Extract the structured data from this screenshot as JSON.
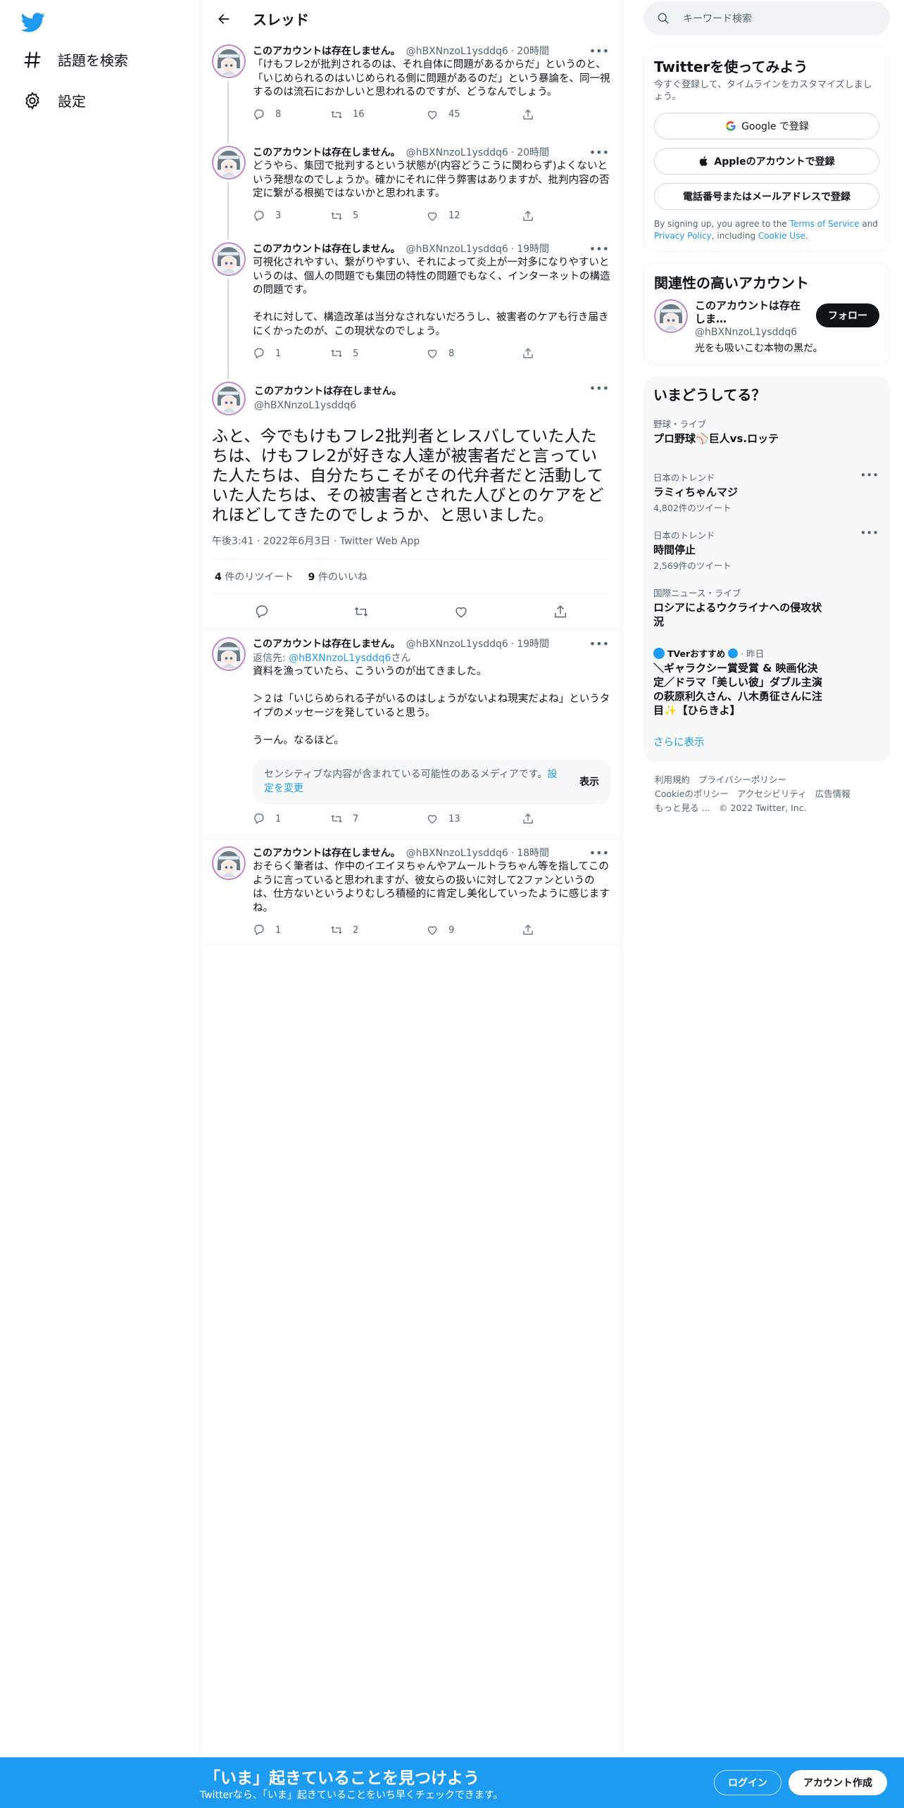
{
  "colors": {
    "accent": "#1d9bf0",
    "text": "#0f1419",
    "muted": "#536471"
  },
  "nav": {
    "explore": "話題を検索",
    "settings": "設定"
  },
  "header": {
    "title": "スレッド"
  },
  "tweets": [
    {
      "name": "このアカウントは存在しません。",
      "handle": "@hBXNnzoL1ysddq6",
      "time": "20時間",
      "text": "「けもフレ2が批判されるのは、それ自体に問題があるからだ」というのと、「いじめられるのはいじめられる側に問題があるのだ」という暴論を、同一視するのは流石におかしいと思われるのですが、どうなんでしょう。",
      "replies": "8",
      "retweets": "16",
      "likes": "45"
    },
    {
      "name": "このアカウントは存在しません。",
      "handle": "@hBXNnzoL1ysddq6",
      "time": "20時間",
      "text": "どうやら、集団で批判するという状態が(内容どうこうに関わらず)よくないという発想なのでしょうか。確かにそれに伴う弊害はありますが、批判内容の否定に繋がる根拠ではないかと思われます。",
      "replies": "3",
      "retweets": "5",
      "likes": "12"
    },
    {
      "name": "このアカウントは存在しません。",
      "handle": "@hBXNnzoL1ysddq6",
      "time": "19時間",
      "text": "可視化されやすい、繋がりやすい、それによって炎上が一対多になりやすいというのは、個人の問題でも集団の特性の問題でもなく、インターネットの構造の問題です。\n\nそれに対して、構造改革は当分なされないだろうし、被害者のケアも行き届きにくかったのが、この現状なのでしょう。",
      "replies": "1",
      "retweets": "5",
      "likes": "8"
    }
  ],
  "focal": {
    "name": "このアカウントは存在しません。",
    "handle": "@hBXNnzoL1ysddq6",
    "text": "ふと、今でもけもフレ2批判者とレスバしていた人たちは、けもフレ2が好きな人達が被害者だと言っていた人たちは、自分たちこそがその代弁者だと活動していた人たちは、その被害者とされた人びとのケアをどれほどしてきたのでしょうか、と思いました。",
    "meta": "午後3:41 · 2022年6月3日 · Twitter Web App",
    "retweet_count": "4",
    "retweet_label": "件のリツイート",
    "like_count": "9",
    "like_label": "件のいいね"
  },
  "replies": [
    {
      "name": "このアカウントは存在しません。",
      "handle": "@hBXNnzoL1ysddq6",
      "time": "19時間",
      "reply_prefix": "返信先: ",
      "reply_handle": "@hBXNnzoL1ysddq6",
      "reply_suffix": "さん",
      "text": "資料を漁っていたら、こういうのが出てきました。\n\n＞２は「いじらめられる子がいるのはしょうがないよね現実だよね」というタイプのメッセージを発していると思う。\n\nうーん。なるほど。",
      "sensitive_msg": "センシティブな内容が含まれている可能性のあるメディアです。",
      "sensitive_link": "設定を変更",
      "sensitive_show": "表示",
      "replies": "1",
      "retweets": "7",
      "likes": "13"
    },
    {
      "name": "このアカウントは存在しません。",
      "handle": "@hBXNnzoL1ysddq6",
      "time": "18時間",
      "text": "おそらく筆者は、作中のイエイヌちゃんやアムールトラちゃん等を指してこのように言っていると思われますが、彼女らの扱いに対して2ファンというのは、仕方ないというよりむしろ積極的に肯定し美化していったように感じますね。",
      "replies": "1",
      "retweets": "2",
      "likes": "9"
    }
  ],
  "search": {
    "placeholder": "キーワード検索"
  },
  "signup_card": {
    "title": "Twitterを使ってみよう",
    "sub": "今すぐ登録して、タイムラインをカスタマイズしましょう。",
    "google": "Google で登録",
    "apple": "Appleのアカウントで登録",
    "phone": "電話番号またはメールアドレスで登録",
    "legal_1": "By signing up, you agree to the ",
    "tos": "Terms of Service",
    "legal_2": " and ",
    "privacy": "Privacy Policy",
    "legal_3": ", including ",
    "cookie": "Cookie Use",
    "legal_4": "."
  },
  "related": {
    "title": "関連性の高いアカウント",
    "name": "このアカウントは存在しま…",
    "handle": "@hBXNnzoL1ysddq6",
    "bio": "光をも吸いこむ本物の黒だ。",
    "follow": "フォロー"
  },
  "trends": {
    "title": "いまどうしてる？",
    "items": [
      {
        "cat": "野球・ライブ",
        "title": "プロ野球⚾巨人vs.ロッテ",
        "count": ""
      },
      {
        "cat": "日本のトレンド",
        "title": "ラミィちゃんマジ",
        "count": "4,802件のツイート"
      },
      {
        "cat": "日本のトレンド",
        "title": "時間停止",
        "count": "2,569件のツイート"
      },
      {
        "cat": "国際ニュース・ライブ",
        "title": "ロシアによるウクライナへの侵攻状況",
        "count": ""
      }
    ],
    "promo_name": "TVerおすすめ",
    "promo_time": "· 昨日",
    "promo_title": "＼ギャラクシー賞受賞 & 映画化決定／ドラマ「美しい彼」ダブル主演の萩原利久さん、八木勇征さんに注目✨【ひらきよ】",
    "show_more": "さらに表示"
  },
  "footer": {
    "terms": "利用規約",
    "privacy": "プライバシーポリシー",
    "cookie": "Cookieのポリシー",
    "accessibility": "アクセシビリティ",
    "ads": "広告情報",
    "more": "もっと見る …",
    "copyright": "© 2022 Twitter, Inc."
  },
  "bottom_bar": {
    "title": "「いま」起きていることを見つけよう",
    "sub": "Twitterなら、「いま」起きていることをいち早くチェックできます。",
    "login": "ログイン",
    "signup": "アカウント作成"
  }
}
